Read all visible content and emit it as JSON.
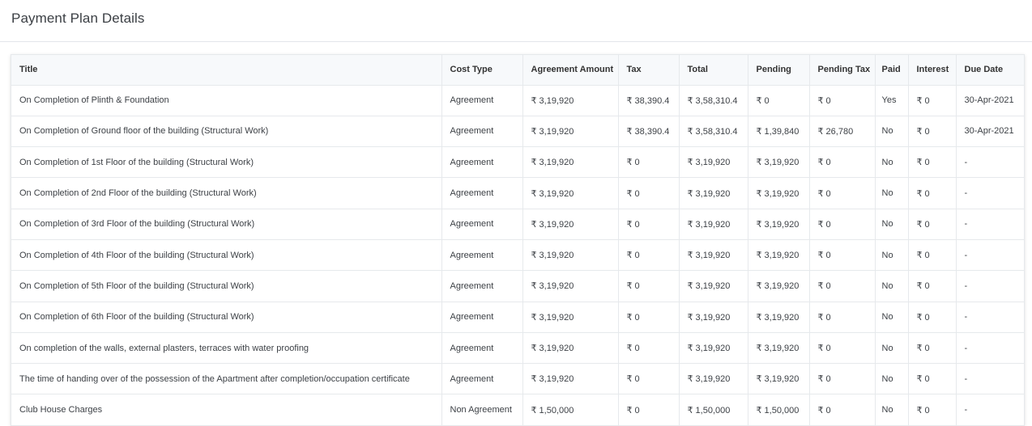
{
  "page": {
    "title": "Payment Plan Details"
  },
  "table": {
    "columns": [
      "Title",
      "Cost Type",
      "Agreement Amount",
      "Tax",
      "Total",
      "Pending",
      "Pending Tax",
      "Paid",
      "Interest",
      "Due Date"
    ],
    "rows": [
      [
        "On Completion of Plinth & Foundation",
        "Agreement",
        "₹ 3,19,920",
        "₹ 38,390.4",
        "₹ 3,58,310.4",
        "₹ 0",
        "₹ 0",
        "Yes",
        "₹ 0",
        "30-Apr-2021"
      ],
      [
        "On Completion of Ground floor of the building (Structural Work)",
        "Agreement",
        "₹ 3,19,920",
        "₹ 38,390.4",
        "₹ 3,58,310.4",
        "₹ 1,39,840",
        "₹ 26,780",
        "No",
        "₹ 0",
        "30-Apr-2021"
      ],
      [
        "On Completion of 1st Floor of the building (Structural Work)",
        "Agreement",
        "₹ 3,19,920",
        "₹ 0",
        "₹ 3,19,920",
        "₹ 3,19,920",
        "₹ 0",
        "No",
        "₹ 0",
        "-"
      ],
      [
        "On Completion of 2nd Floor of the building (Structural Work)",
        "Agreement",
        "₹ 3,19,920",
        "₹ 0",
        "₹ 3,19,920",
        "₹ 3,19,920",
        "₹ 0",
        "No",
        "₹ 0",
        "-"
      ],
      [
        "On Completion of 3rd Floor of the building (Structural Work)",
        "Agreement",
        "₹ 3,19,920",
        "₹ 0",
        "₹ 3,19,920",
        "₹ 3,19,920",
        "₹ 0",
        "No",
        "₹ 0",
        "-"
      ],
      [
        "On Completion of 4th Floor of the building (Structural Work)",
        "Agreement",
        "₹ 3,19,920",
        "₹ 0",
        "₹ 3,19,920",
        "₹ 3,19,920",
        "₹ 0",
        "No",
        "₹ 0",
        "-"
      ],
      [
        "On Completion of 5th Floor of the building (Structural Work)",
        "Agreement",
        "₹ 3,19,920",
        "₹ 0",
        "₹ 3,19,920",
        "₹ 3,19,920",
        "₹ 0",
        "No",
        "₹ 0",
        "-"
      ],
      [
        "On Completion of 6th Floor of the building (Structural Work)",
        "Agreement",
        "₹ 3,19,920",
        "₹ 0",
        "₹ 3,19,920",
        "₹ 3,19,920",
        "₹ 0",
        "No",
        "₹ 0",
        "-"
      ],
      [
        "On completion of the walls, external plasters, terraces with water proofing",
        "Agreement",
        "₹ 3,19,920",
        "₹ 0",
        "₹ 3,19,920",
        "₹ 3,19,920",
        "₹ 0",
        "No",
        "₹ 0",
        "-"
      ],
      [
        "The time of handing over of the possession of the Apartment after completion/occupation certificate",
        "Agreement",
        "₹ 3,19,920",
        "₹ 0",
        "₹ 3,19,920",
        "₹ 3,19,920",
        "₹ 0",
        "No",
        "₹ 0",
        "-"
      ],
      [
        "Club House Charges",
        "Non Agreement",
        "₹ 1,50,000",
        "₹ 0",
        "₹ 1,50,000",
        "₹ 1,50,000",
        "₹ 0",
        "No",
        "₹ 0",
        "-"
      ]
    ]
  }
}
